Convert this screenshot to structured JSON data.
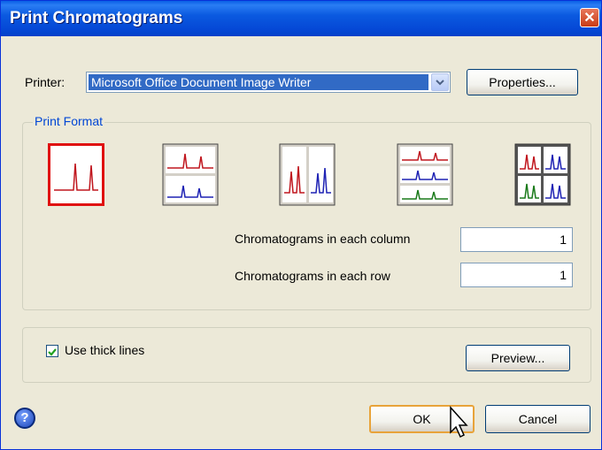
{
  "dialog": {
    "title": "Print Chromatograms",
    "close_icon": "close-icon"
  },
  "printer": {
    "label": "Printer:",
    "selected": "Microsoft Office Document Image Writer",
    "dropdown_icon": "chevron-down-icon",
    "properties_label": "Properties..."
  },
  "print_format": {
    "legend": "Print Format",
    "layouts": [
      {
        "name": "single",
        "selected": true
      },
      {
        "name": "two-rows",
        "selected": false
      },
      {
        "name": "two-columns",
        "selected": false
      },
      {
        "name": "three-rows",
        "selected": false
      },
      {
        "name": "two-by-two-grid",
        "selected": false
      }
    ],
    "colors": {
      "red": "#c0161e",
      "blue": "#1e22b4",
      "green": "#1a7a1a",
      "selected_border": "#e01010"
    },
    "column_label": "Chromatograms in each column",
    "column_value": "1",
    "row_label": "Chromatograms in each row",
    "row_value": "1"
  },
  "options": {
    "thick_lines_label": "Use thick lines",
    "thick_lines_checked": true,
    "preview_label": "Preview..."
  },
  "footer": {
    "help_icon": "help-icon",
    "ok_label": "OK",
    "cancel_label": "Cancel",
    "cursor_icon": "mouse-pointer-icon"
  }
}
